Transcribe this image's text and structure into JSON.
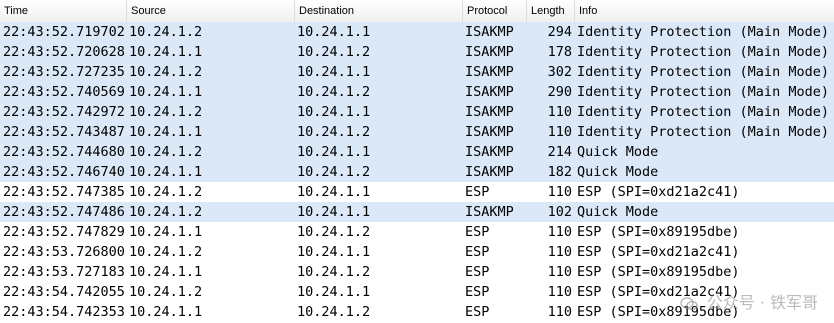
{
  "columns": {
    "time": "Time",
    "source": "Source",
    "destination": "Destination",
    "protocol": "Protocol",
    "length": "Length",
    "info": "Info"
  },
  "packets": [
    {
      "time": "22:43:52.719702",
      "source": "10.24.1.2",
      "destination": "10.24.1.1",
      "protocol": "ISAKMP",
      "length": "294",
      "info": "Identity Protection (Main Mode)"
    },
    {
      "time": "22:43:52.720628",
      "source": "10.24.1.1",
      "destination": "10.24.1.2",
      "protocol": "ISAKMP",
      "length": "178",
      "info": "Identity Protection (Main Mode)"
    },
    {
      "time": "22:43:52.727235",
      "source": "10.24.1.2",
      "destination": "10.24.1.1",
      "protocol": "ISAKMP",
      "length": "302",
      "info": "Identity Protection (Main Mode)"
    },
    {
      "time": "22:43:52.740569",
      "source": "10.24.1.1",
      "destination": "10.24.1.2",
      "protocol": "ISAKMP",
      "length": "290",
      "info": "Identity Protection (Main Mode)"
    },
    {
      "time": "22:43:52.742972",
      "source": "10.24.1.2",
      "destination": "10.24.1.1",
      "protocol": "ISAKMP",
      "length": "110",
      "info": "Identity Protection (Main Mode)"
    },
    {
      "time": "22:43:52.743487",
      "source": "10.24.1.1",
      "destination": "10.24.1.2",
      "protocol": "ISAKMP",
      "length": "110",
      "info": "Identity Protection (Main Mode)"
    },
    {
      "time": "22:43:52.744680",
      "source": "10.24.1.2",
      "destination": "10.24.1.1",
      "protocol": "ISAKMP",
      "length": "214",
      "info": "Quick Mode"
    },
    {
      "time": "22:43:52.746740",
      "source": "10.24.1.1",
      "destination": "10.24.1.2",
      "protocol": "ISAKMP",
      "length": "182",
      "info": "Quick Mode"
    },
    {
      "time": "22:43:52.747385",
      "source": "10.24.1.2",
      "destination": "10.24.1.1",
      "protocol": "ESP",
      "length": "110",
      "info": "ESP (SPI=0xd21a2c41)"
    },
    {
      "time": "22:43:52.747486",
      "source": "10.24.1.2",
      "destination": "10.24.1.1",
      "protocol": "ISAKMP",
      "length": "102",
      "info": "Quick Mode"
    },
    {
      "time": "22:43:52.747829",
      "source": "10.24.1.1",
      "destination": "10.24.1.2",
      "protocol": "ESP",
      "length": "110",
      "info": "ESP (SPI=0x89195dbe)"
    },
    {
      "time": "22:43:53.726800",
      "source": "10.24.1.2",
      "destination": "10.24.1.1",
      "protocol": "ESP",
      "length": "110",
      "info": "ESP (SPI=0xd21a2c41)"
    },
    {
      "time": "22:43:53.727183",
      "source": "10.24.1.1",
      "destination": "10.24.1.2",
      "protocol": "ESP",
      "length": "110",
      "info": "ESP (SPI=0x89195dbe)"
    },
    {
      "time": "22:43:54.742055",
      "source": "10.24.1.2",
      "destination": "10.24.1.1",
      "protocol": "ESP",
      "length": "110",
      "info": "ESP (SPI=0xd21a2c41)"
    },
    {
      "time": "22:43:54.742353",
      "source": "10.24.1.1",
      "destination": "10.24.1.2",
      "protocol": "ESP",
      "length": "110",
      "info": "ESP (SPI=0x89195dbe)"
    }
  ],
  "colors": {
    "isakmp_row": "#dae8f8",
    "esp_row": "#ffffff"
  },
  "watermark": {
    "text": "公众号 · 铁军哥",
    "icon": "wechat-icon"
  }
}
